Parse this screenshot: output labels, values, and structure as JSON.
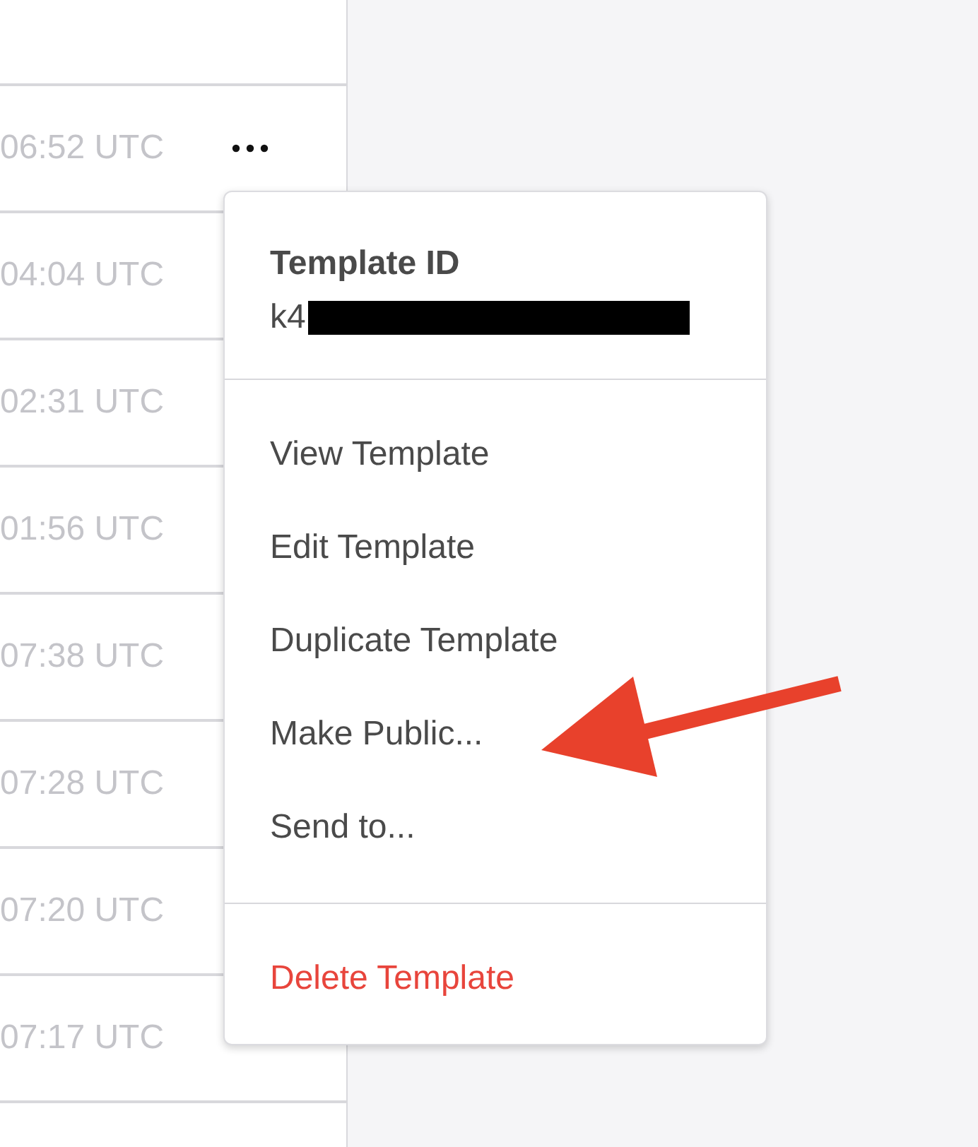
{
  "rows": [
    {
      "time": "06:52 UTC"
    },
    {
      "time": "04:04 UTC"
    },
    {
      "time": "02:31 UTC"
    },
    {
      "time": "01:56 UTC"
    },
    {
      "time": "07:38 UTC"
    },
    {
      "time": "07:28 UTC"
    },
    {
      "time": "07:20 UTC"
    },
    {
      "time": "07:17 UTC"
    }
  ],
  "menu": {
    "header_label": "Template ID",
    "header_value": "k4",
    "groups": [
      [
        {
          "label": "View Template",
          "kind": "normal"
        },
        {
          "label": "Edit Template",
          "kind": "normal"
        },
        {
          "label": "Duplicate Template",
          "kind": "normal"
        },
        {
          "label": "Make Public...",
          "kind": "normal"
        },
        {
          "label": "Send to...",
          "kind": "normal"
        }
      ],
      [
        {
          "label": "Delete Template",
          "kind": "danger"
        }
      ]
    ]
  },
  "annotation": {
    "kind": "arrow"
  }
}
